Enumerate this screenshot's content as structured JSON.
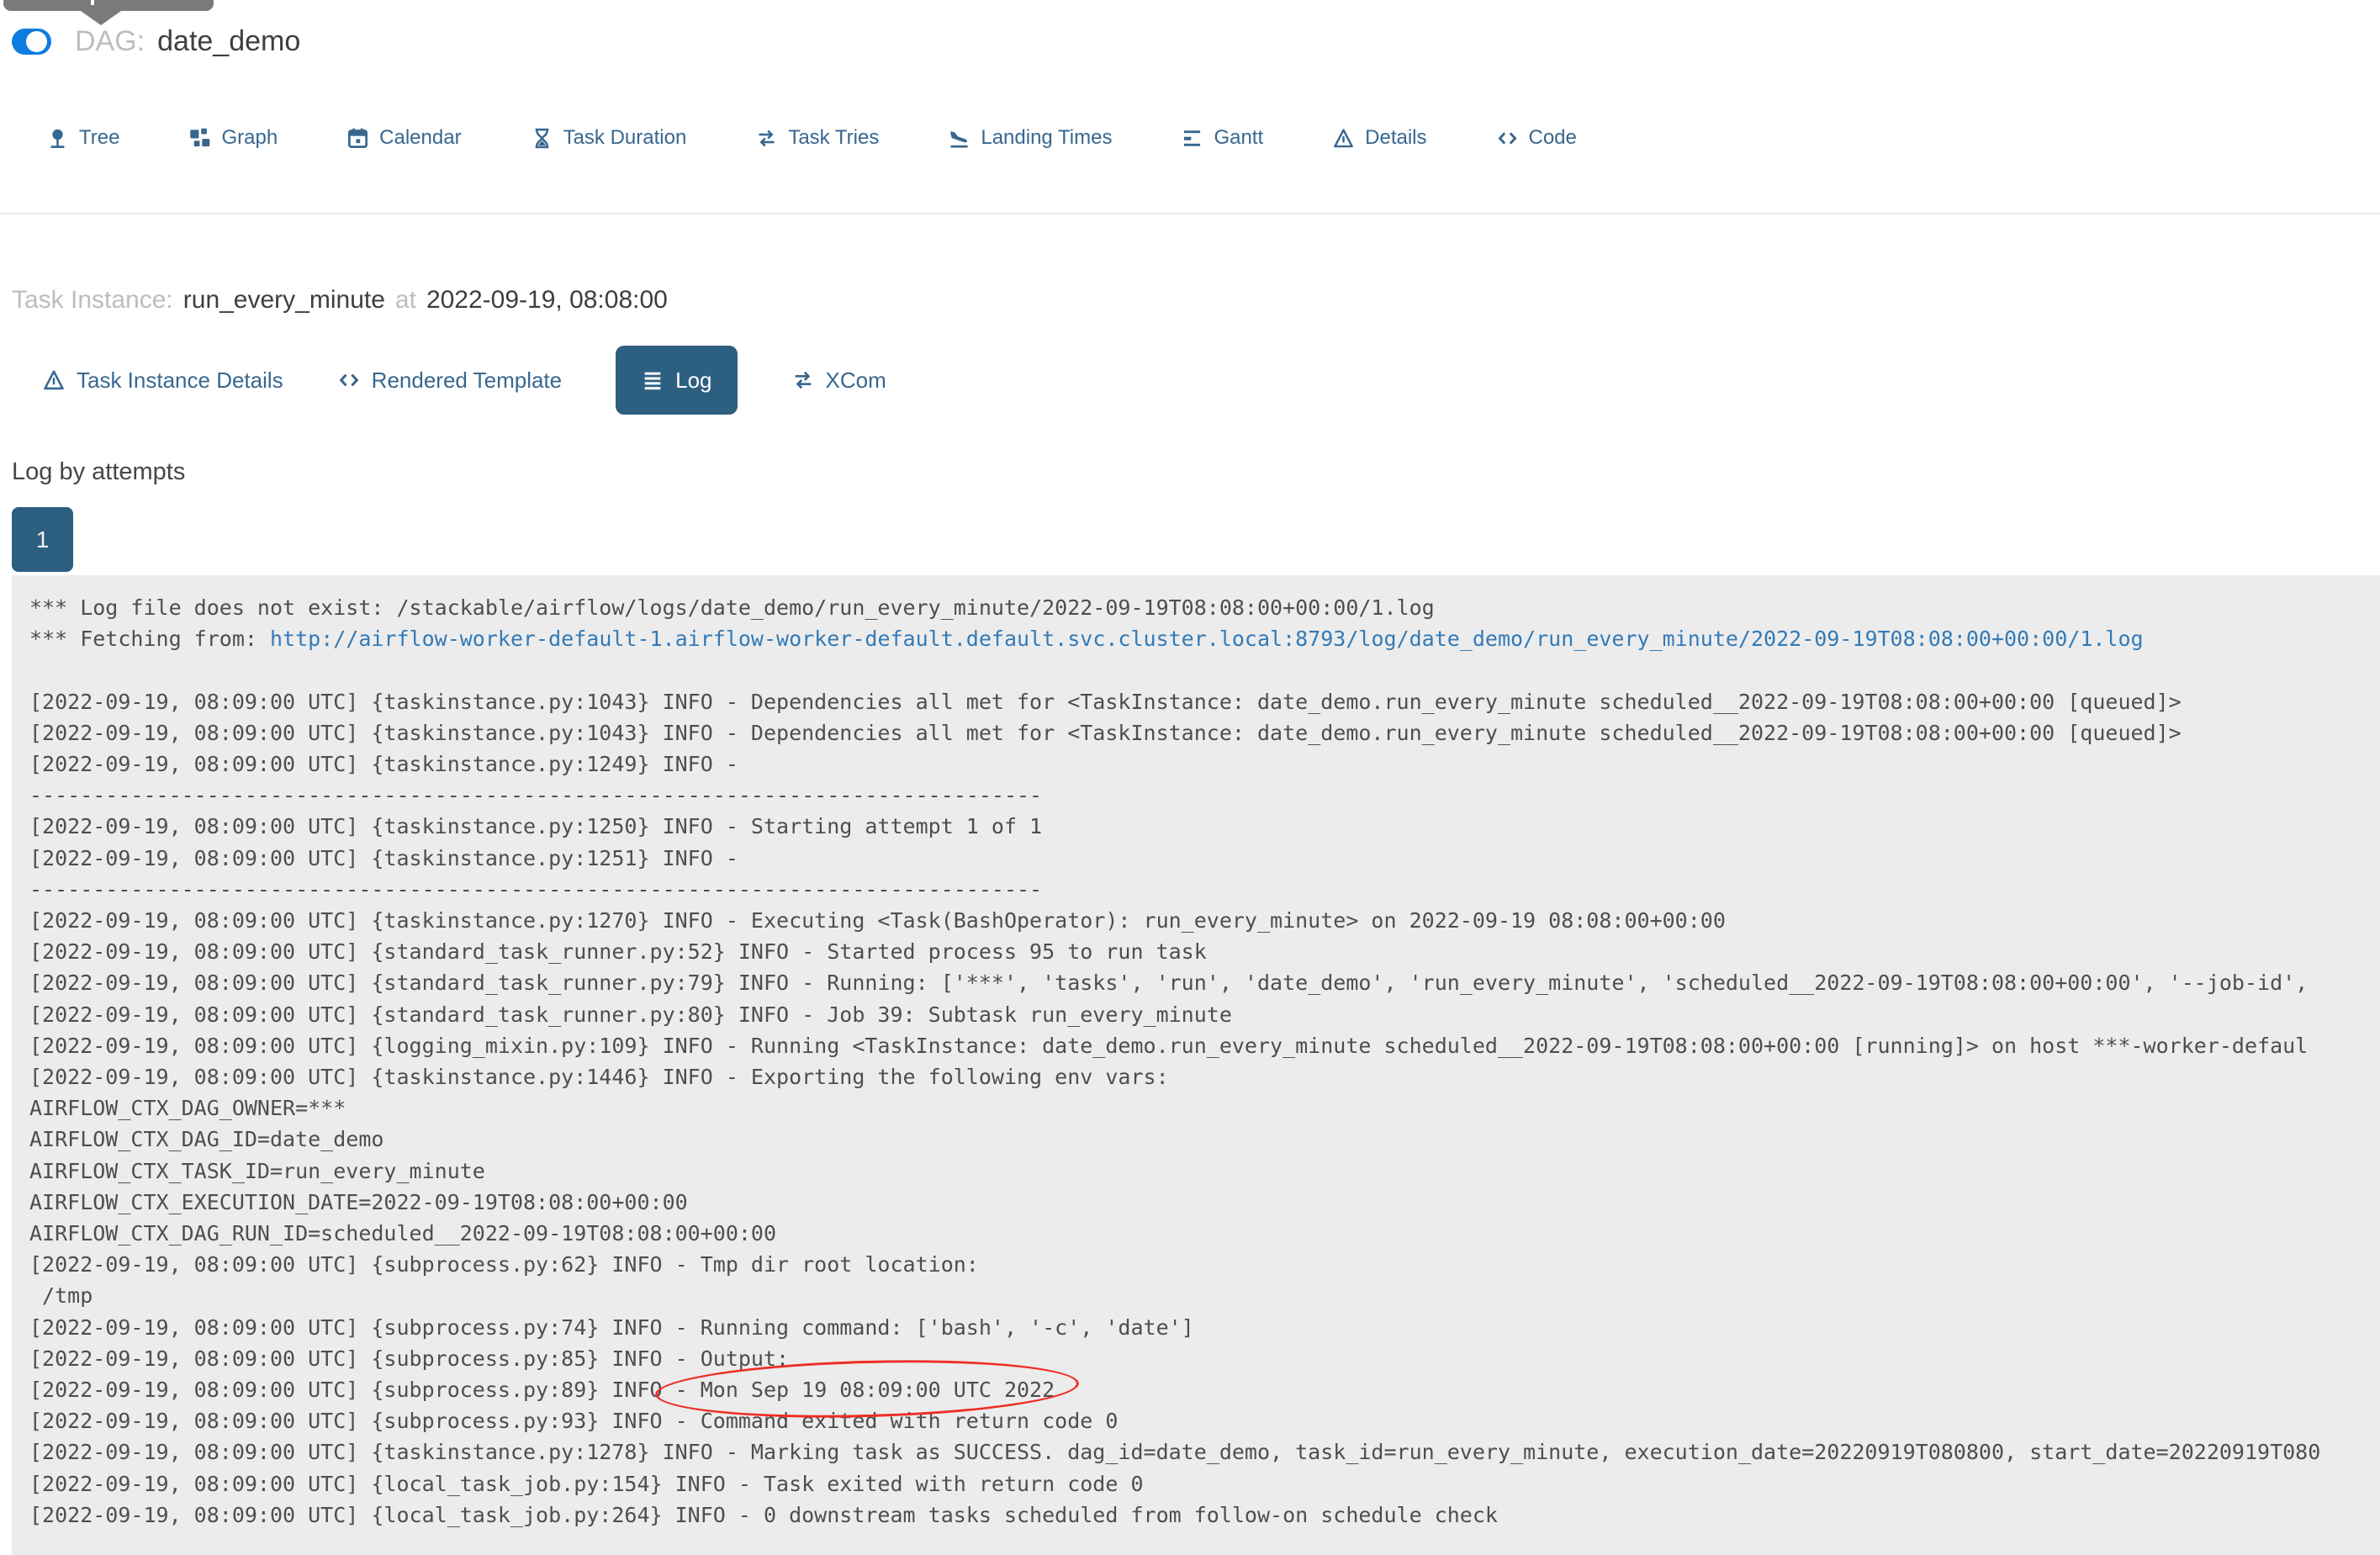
{
  "page": {
    "title_label": "DAG:",
    "title": "date_demo"
  },
  "toggle": {
    "state": "on"
  },
  "nav": {
    "tabs": [
      {
        "label": "Tree",
        "icon": "tree-icon"
      },
      {
        "label": "Graph",
        "icon": "graph-icon"
      },
      {
        "label": "Calendar",
        "icon": "calendar-icon"
      },
      {
        "label": "Task Duration",
        "icon": "hourglass-icon"
      },
      {
        "label": "Task Tries",
        "icon": "repeat-icon"
      },
      {
        "label": "Landing Times",
        "icon": "plane-landing-icon"
      },
      {
        "label": "Gantt",
        "icon": "gantt-icon"
      },
      {
        "label": "Details",
        "icon": "warning-triangle-icon"
      },
      {
        "label": "Code",
        "icon": "code-icon"
      }
    ]
  },
  "task_instance": {
    "label": "Task Instance:",
    "task_id": "run_every_minute",
    "at_label": "at",
    "run_date": "2022-09-19, 08:08:00"
  },
  "sub_tabs": {
    "items": [
      {
        "label": "Task Instance Details",
        "icon": "warning-triangle-icon",
        "active": false
      },
      {
        "label": "Rendered Template",
        "icon": "code-icon",
        "active": false
      },
      {
        "label": "Log",
        "icon": "list-icon",
        "active": true
      },
      {
        "label": "XCom",
        "icon": "exchange-icon",
        "active": false
      }
    ]
  },
  "log_section": {
    "heading": "Log by attempts",
    "attempt": "1"
  },
  "log": {
    "lines": [
      {
        "text": "*** Log file does not exist: /stackable/airflow/logs/date_demo/run_every_minute/2022-09-19T08:08:00+00:00/1.log"
      },
      {
        "pre": "*** Fetching from: ",
        "url": "http://airflow-worker-default-1.airflow-worker-default.default.svc.cluster.local:8793/log/date_demo/run_every_minute/2022-09-19T08:08:00+00:00/1.log"
      },
      {
        "text": ""
      },
      {
        "text": "[2022-09-19, 08:09:00 UTC] {taskinstance.py:1043} INFO - Dependencies all met for <TaskInstance: date_demo.run_every_minute scheduled__2022-09-19T08:08:00+00:00 [queued]>"
      },
      {
        "text": "[2022-09-19, 08:09:00 UTC] {taskinstance.py:1043} INFO - Dependencies all met for <TaskInstance: date_demo.run_every_minute scheduled__2022-09-19T08:08:00+00:00 [queued]>"
      },
      {
        "text": "[2022-09-19, 08:09:00 UTC] {taskinstance.py:1249} INFO - "
      },
      {
        "text": "--------------------------------------------------------------------------------"
      },
      {
        "text": "[2022-09-19, 08:09:00 UTC] {taskinstance.py:1250} INFO - Starting attempt 1 of 1"
      },
      {
        "text": "[2022-09-19, 08:09:00 UTC] {taskinstance.py:1251} INFO - "
      },
      {
        "text": "--------------------------------------------------------------------------------"
      },
      {
        "text": "[2022-09-19, 08:09:00 UTC] {taskinstance.py:1270} INFO - Executing <Task(BashOperator): run_every_minute> on 2022-09-19 08:08:00+00:00"
      },
      {
        "text": "[2022-09-19, 08:09:00 UTC] {standard_task_runner.py:52} INFO - Started process 95 to run task"
      },
      {
        "text": "[2022-09-19, 08:09:00 UTC] {standard_task_runner.py:79} INFO - Running: ['***', 'tasks', 'run', 'date_demo', 'run_every_minute', 'scheduled__2022-09-19T08:08:00+00:00', '--job-id',"
      },
      {
        "text": "[2022-09-19, 08:09:00 UTC] {standard_task_runner.py:80} INFO - Job 39: Subtask run_every_minute"
      },
      {
        "text": "[2022-09-19, 08:09:00 UTC] {logging_mixin.py:109} INFO - Running <TaskInstance: date_demo.run_every_minute scheduled__2022-09-19T08:08:00+00:00 [running]> on host ***-worker-defaul"
      },
      {
        "text": "[2022-09-19, 08:09:00 UTC] {taskinstance.py:1446} INFO - Exporting the following env vars:"
      },
      {
        "text": "AIRFLOW_CTX_DAG_OWNER=***"
      },
      {
        "text": "AIRFLOW_CTX_DAG_ID=date_demo"
      },
      {
        "text": "AIRFLOW_CTX_TASK_ID=run_every_minute"
      },
      {
        "text": "AIRFLOW_CTX_EXECUTION_DATE=2022-09-19T08:08:00+00:00"
      },
      {
        "text": "AIRFLOW_CTX_DAG_RUN_ID=scheduled__2022-09-19T08:08:00+00:00"
      },
      {
        "text": "[2022-09-19, 08:09:00 UTC] {subprocess.py:62} INFO - Tmp dir root location: "
      },
      {
        "text": " /tmp"
      },
      {
        "text": "[2022-09-19, 08:09:00 UTC] {subprocess.py:74} INFO - Running command: ['bash', '-c', 'date']"
      },
      {
        "text": "[2022-09-19, 08:09:00 UTC] {subprocess.py:85} INFO - Output:"
      },
      {
        "pre": "[2022-09-19, 08:09:00 UTC] {subprocess.py:89} INFO ",
        "circled": "- Mon Sep 19 08:09:00 UTC 2022"
      },
      {
        "text": "[2022-09-19, 08:09:00 UTC] {subprocess.py:93} INFO - Command exited with return code 0"
      },
      {
        "text": "[2022-09-19, 08:09:00 UTC] {taskinstance.py:1278} INFO - Marking task as SUCCESS. dag_id=date_demo, task_id=run_every_minute, execution_date=20220919T080800, start_date=20220919T080"
      },
      {
        "text": "[2022-09-19, 08:09:00 UTC] {local_task_job.py:154} INFO - Task exited with return code 0"
      },
      {
        "text": "[2022-09-19, 08:09:00 UTC] {local_task_job.py:264} INFO - 0 downstream tasks scheduled from follow-on schedule check"
      }
    ]
  },
  "colors": {
    "toggle_blue": "#0d7ce2",
    "nav_link": "#38678f",
    "active_tab_bg": "#2d5f81",
    "log_bg": "#ececec",
    "log_text": "#4e4e4e",
    "log_link": "#337ab7",
    "annotation_red": "#ee2e24",
    "muted_text": "#bdbdbd"
  }
}
